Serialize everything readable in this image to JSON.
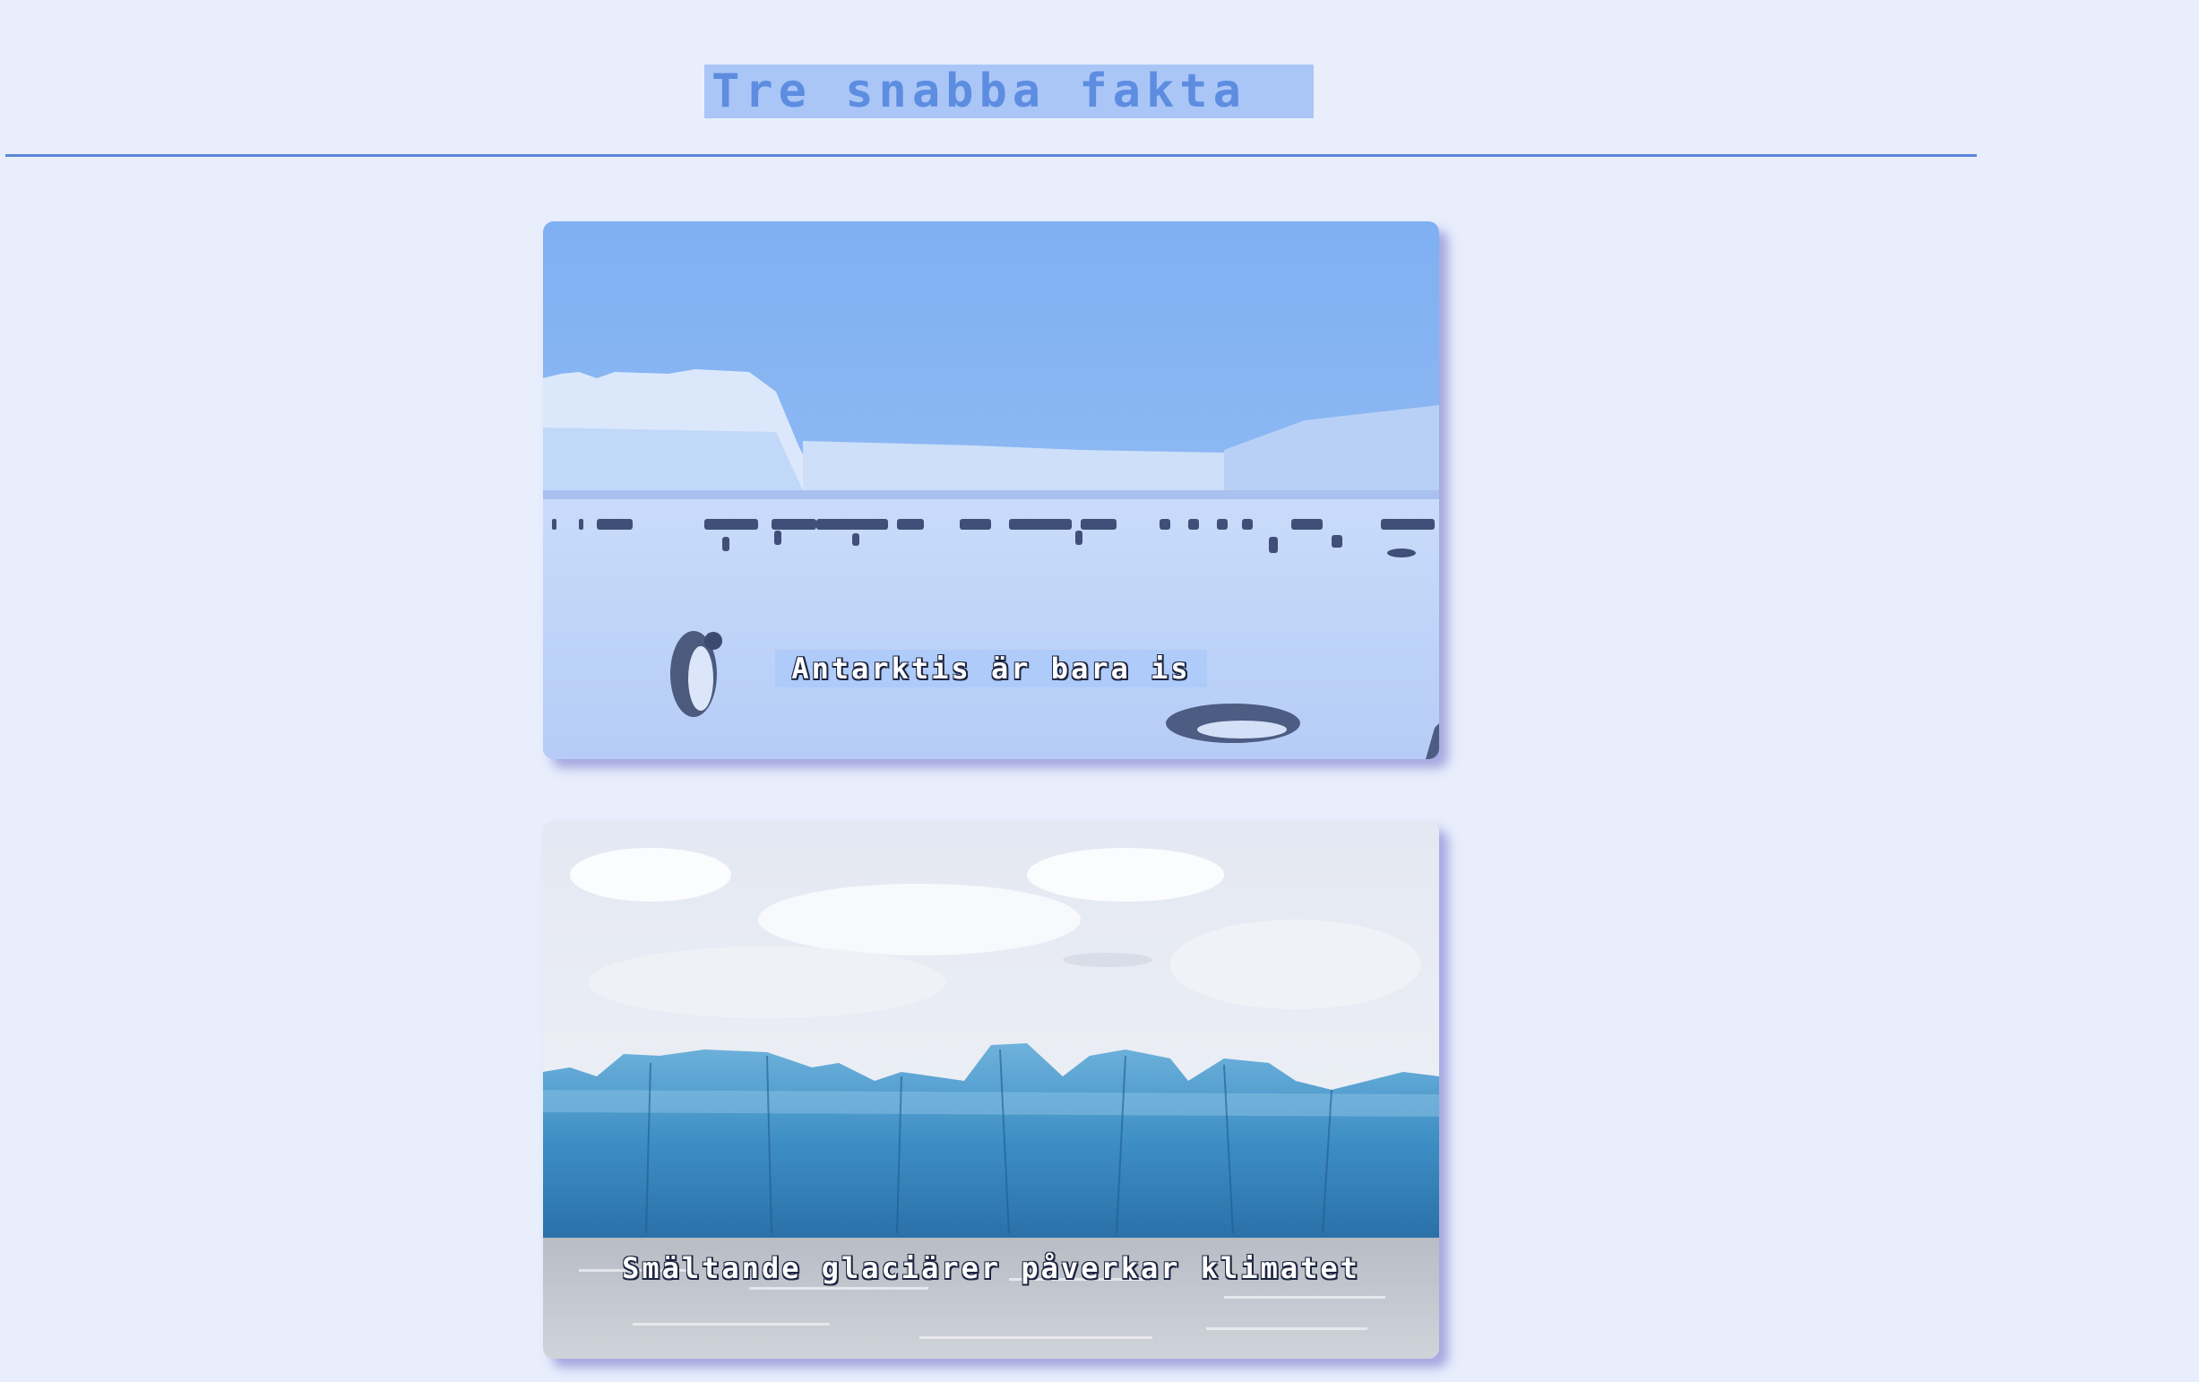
{
  "header": {
    "title": "Tre snabba fakta"
  },
  "cards": [
    {
      "image": "antarctic-penguins-ice-shelf",
      "caption": "Antarktis är bara is"
    },
    {
      "image": "melting-glacier-wall",
      "caption": "Smältande glaciärer påverkar klimatet"
    }
  ],
  "colors": {
    "background": "#e8eefc",
    "title_highlight": "#aac6f7",
    "title_text": "#5d8de0",
    "rule": "#5b85d8"
  }
}
